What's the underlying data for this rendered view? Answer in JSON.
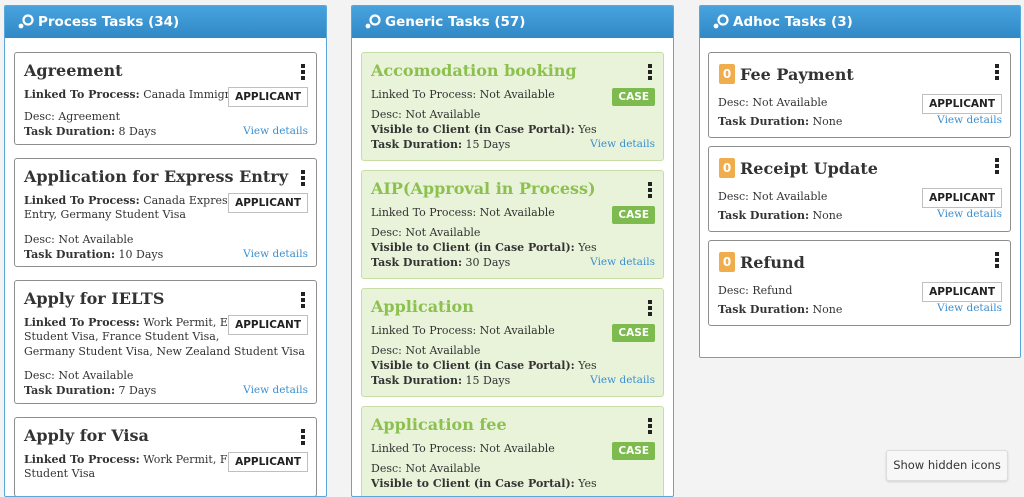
{
  "panels": {
    "process": {
      "title": "Process Tasks (34)",
      "cards": [
        {
          "title": "Agreement",
          "linked_label": "Linked To Process:",
          "linked_value": "Canada Immigration",
          "desc": "Desc: Agreement",
          "duration_label": "Task Duration:",
          "duration_value": "8 Days",
          "badge": "APPLICANT",
          "link": "View details"
        },
        {
          "title": "Application for Express Entry",
          "linked_label": "Linked To Process:",
          "linked_value": "Canada Express",
          "linked_value2": "Entry, Germany Student Visa",
          "desc": "Desc: Not Available",
          "duration_label": "Task Duration:",
          "duration_value": "10 Days",
          "badge": "APPLICANT",
          "link": "View details"
        },
        {
          "title": "Apply for IELTS",
          "linked_label": "Linked To Process:",
          "linked_value": "Work Permit, Europe",
          "linked_value2": "Student Visa, France Student Visa,",
          "linked_value3": "Germany Student Visa, New Zealand Student Visa",
          "desc": "Desc: Not Available",
          "duration_label": "Task Duration:",
          "duration_value": "7 Days",
          "badge": "APPLICANT",
          "link": "View details"
        },
        {
          "title": "Apply for Visa",
          "linked_label": "Linked To Process:",
          "linked_value": "Work Permit, France",
          "linked_value2": "Student Visa",
          "badge": "APPLICANT"
        }
      ]
    },
    "generic": {
      "title": "Generic Tasks (57)",
      "cards": [
        {
          "title": "Accomodation booking",
          "linked": "Linked To Process: Not Available",
          "desc": "Desc: Not Available",
          "visible_label": "Visible to Client (in Case Portal):",
          "visible_value": "Yes",
          "duration_label": "Task Duration:",
          "duration_value": "15 Days",
          "badge": "CASE",
          "link": "View details"
        },
        {
          "title": "AIP(Approval in Process)",
          "linked": "Linked To Process: Not Available",
          "desc": "Desc: Not Available",
          "visible_label": "Visible to Client (in Case Portal):",
          "visible_value": "Yes",
          "duration_label": "Task Duration:",
          "duration_value": "30 Days",
          "badge": "CASE",
          "link": "View details"
        },
        {
          "title": "Application",
          "linked": "Linked To Process: Not Available",
          "desc": "Desc: Not Available",
          "visible_label": "Visible to Client (in Case Portal):",
          "visible_value": "Yes",
          "duration_label": "Task Duration:",
          "duration_value": "15 Days",
          "badge": "CASE",
          "link": "View details"
        },
        {
          "title": "Application fee",
          "linked": "Linked To Process: Not Available",
          "desc": "Desc: Not Available",
          "visible_label": "Visible to Client (in Case Portal):",
          "visible_value": "Yes",
          "badge": "CASE"
        }
      ]
    },
    "adhoc": {
      "title": "Adhoc Tasks (3)",
      "cards": [
        {
          "count": "0",
          "title": "Fee Payment",
          "desc": "Desc: Not Available",
          "duration_label": "Task Duration:",
          "duration_value": "None",
          "badge": "APPLICANT",
          "link": "View details"
        },
        {
          "count": "0",
          "title": "Receipt Update",
          "desc": "Desc: Not Available",
          "duration_label": "Task Duration:",
          "duration_value": "None",
          "badge": "APPLICANT",
          "link": "View details"
        },
        {
          "count": "0",
          "title": "Refund",
          "desc": "Desc: Refund",
          "duration_label": "Task Duration:",
          "duration_value": "None",
          "badge": "APPLICANT",
          "link": "View details"
        }
      ]
    }
  },
  "show_hidden_icons": "Show hidden icons",
  "colors": {
    "header": "#3a92cf",
    "generic_title": "#8cc04f",
    "case_badge": "#7dbb4e",
    "count_badge": "#f0ad4e",
    "link": "#3b8fd0"
  }
}
